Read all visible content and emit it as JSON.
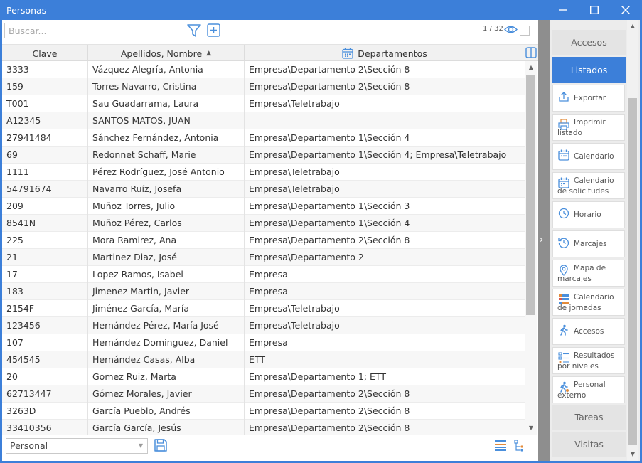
{
  "window": {
    "title": "Personas",
    "minimize": "─",
    "maximize": "☐",
    "close": "✕"
  },
  "toolbar": {
    "search_placeholder": "Buscar...",
    "counter": "1 / 32"
  },
  "table": {
    "columns": [
      "Clave",
      "Apellidos, Nombre",
      "Departamentos"
    ],
    "sorted_column": "Apellidos, Nombre",
    "sort_direction": "ascending",
    "rows": [
      {
        "clave": "3333",
        "nombre": "Vázquez Alegría, Antonia",
        "dept": "Empresa\\Departamento 2\\Sección 8"
      },
      {
        "clave": "159",
        "nombre": "Torres Navarro, Cristina",
        "dept": "Empresa\\Departamento 2\\Sección 8"
      },
      {
        "clave": "T001",
        "nombre": "Sau Guadarrama, Laura",
        "dept": "Empresa\\Teletrabajo"
      },
      {
        "clave": "A12345",
        "nombre": "SANTOS MATOS, JUAN",
        "dept": ""
      },
      {
        "clave": "27941484",
        "nombre": "Sánchez Fernández, Antonia",
        "dept": "Empresa\\Departamento 1\\Sección 4"
      },
      {
        "clave": "69",
        "nombre": "Redonnet Schaff, Marie",
        "dept": "Empresa\\Departamento 1\\Sección 4; Empresa\\Teletrabajo"
      },
      {
        "clave": "1111",
        "nombre": "Pérez Rodríguez, José Antonio",
        "dept": "Empresa\\Teletrabajo"
      },
      {
        "clave": "54791674",
        "nombre": "Navarro Ruíz, Josefa",
        "dept": "Empresa\\Teletrabajo"
      },
      {
        "clave": "209",
        "nombre": "Muñoz Torres, Julio",
        "dept": "Empresa\\Departamento 1\\Sección 3"
      },
      {
        "clave": "8541N",
        "nombre": "Muñoz Pérez, Carlos",
        "dept": "Empresa\\Departamento 1\\Sección 4"
      },
      {
        "clave": "225",
        "nombre": "Mora Ramirez, Ana",
        "dept": "Empresa\\Departamento 2\\Sección 8"
      },
      {
        "clave": "21",
        "nombre": "Martinez Diaz, José",
        "dept": "Empresa\\Departamento 2"
      },
      {
        "clave": "17",
        "nombre": "Lopez Ramos, Isabel",
        "dept": "Empresa"
      },
      {
        "clave": "183",
        "nombre": "Jimenez Martin, Javier",
        "dept": "Empresa"
      },
      {
        "clave": "2154F",
        "nombre": "Jiménez García, María",
        "dept": "Empresa\\Teletrabajo"
      },
      {
        "clave": "123456",
        "nombre": "Hernández Pérez, María José",
        "dept": "Empresa\\Teletrabajo"
      },
      {
        "clave": "107",
        "nombre": "Hernández Dominguez, Daniel",
        "dept": "Empresa"
      },
      {
        "clave": "454545",
        "nombre": "Hernández Casas, Alba",
        "dept": "ETT"
      },
      {
        "clave": "20",
        "nombre": "Gomez Ruiz, Marta",
        "dept": "Empresa\\Departamento 1; ETT"
      },
      {
        "clave": "62713447",
        "nombre": "Gómez Morales, Javier",
        "dept": "Empresa\\Departamento 2\\Sección 8"
      },
      {
        "clave": "3263D",
        "nombre": "García Pueblo, Andrés",
        "dept": "Empresa\\Departamento 2\\Sección 8"
      },
      {
        "clave": "33410356",
        "nombre": "García García, Jesús",
        "dept": "Empresa\\Departamento 2\\Sección 8"
      }
    ]
  },
  "bottombar": {
    "view_selected": "Personal"
  },
  "panel": {
    "sections": {
      "accesos": "Accesos",
      "listados": "Listados",
      "tareas": "Tareas",
      "visitas": "Visitas"
    },
    "actions": [
      {
        "label": "Exportar",
        "icon": "export-icon"
      },
      {
        "label": "Imprimir listado",
        "icon": "print-icon"
      },
      {
        "label": "Calendario",
        "icon": "calendar-icon"
      },
      {
        "label": "Calendario de solicitudes",
        "icon": "calendar-requests-icon"
      },
      {
        "label": "Horario",
        "icon": "clock-icon"
      },
      {
        "label": "Marcajes",
        "icon": "history-icon"
      },
      {
        "label": "Mapa de marcajes",
        "icon": "map-pin-icon"
      },
      {
        "label": "Calendario de jornadas",
        "icon": "workday-calendar-icon"
      },
      {
        "label": "Accesos",
        "icon": "walking-person-icon"
      },
      {
        "label": "Resultados por niveles",
        "icon": "levels-icon"
      },
      {
        "label": "Personal externo",
        "icon": "external-person-icon"
      }
    ]
  },
  "colors": {
    "accent": "#3c7fd9",
    "icon": "#4a8fdc",
    "splitter": "#8e8e8e"
  }
}
